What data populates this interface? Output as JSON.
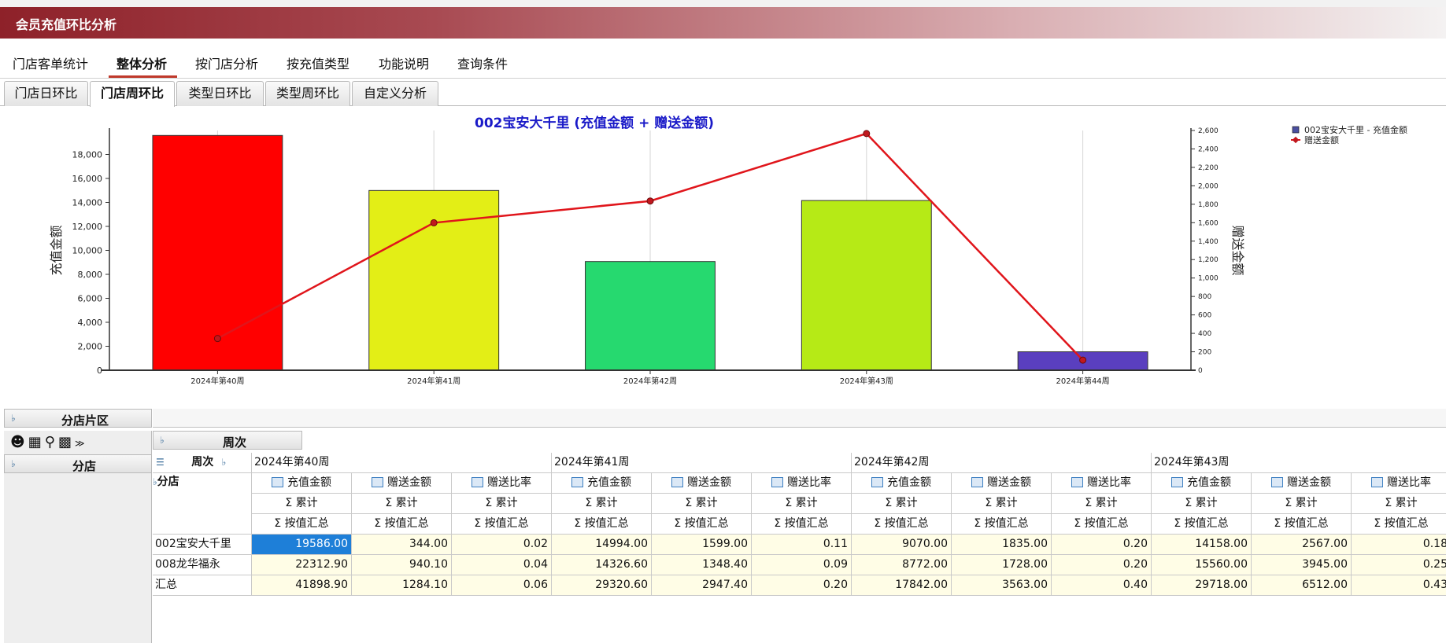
{
  "window": {
    "title": "会员充值环比分析"
  },
  "menu": {
    "items": [
      "门店客单统计",
      "整体分析",
      "按门店分析",
      "按充值类型",
      "功能说明",
      "查询条件"
    ],
    "active_index": 1
  },
  "tabs": {
    "items": [
      "门店日环比",
      "门店周环比",
      "类型日环比",
      "类型周环比",
      "自定义分析"
    ],
    "active_index": 1
  },
  "chart_data": {
    "type": "bar",
    "title": "002宝安大千里 (充值金额 + 赠送金额)",
    "categories": [
      "2024年第40周",
      "2024年第41周",
      "2024年第42周",
      "2024年第43周",
      "2024年第44周"
    ],
    "series": [
      {
        "name": "002宝安大千里 - 充值金额",
        "type": "bar",
        "axis": "left",
        "values": [
          19586,
          14994,
          9070,
          14158,
          1540
        ],
        "colors": [
          "#ff0000",
          "#e3ee16",
          "#26d96f",
          "#b6ea16",
          "#5a3fbf"
        ]
      },
      {
        "name": "赠送金额",
        "type": "line",
        "axis": "right",
        "values": [
          344,
          1599,
          1835,
          2567,
          110
        ],
        "color": "#e0151b"
      }
    ],
    "ylabel": "充值金额",
    "y2label": "赠送金额",
    "ylim": [
      0,
      20000
    ],
    "y2lim": [
      0,
      2600
    ],
    "yticks": [
      "0",
      "2,000",
      "4,000",
      "6,000",
      "8,000",
      "10,000",
      "12,000",
      "14,000",
      "16,000",
      "18,000"
    ],
    "y2ticks": [
      "0",
      "200",
      "400",
      "600",
      "800",
      "1,000",
      "1,200",
      "1,400",
      "1,600",
      "1,800",
      "2,000",
      "2,200",
      "2,400",
      "2,600"
    ],
    "legend_position": "top-right",
    "grid": true
  },
  "pivot": {
    "region_field": "分店片区",
    "column_field": "周次",
    "row_field": "分店",
    "col_header_field": "周次",
    "weeks": [
      "2024年第40周",
      "2024年第41周",
      "2024年第42周",
      "2024年第43周"
    ],
    "measures": [
      "充值金额",
      "赠送金额",
      "赠送比率"
    ],
    "agg1": "Σ 累计",
    "agg2": "Σ 按值汇总",
    "rows": [
      {
        "label": "002宝安大千里",
        "values": [
          "19586.00",
          "344.00",
          "0.02",
          "14994.00",
          "1599.00",
          "0.11",
          "9070.00",
          "1835.00",
          "0.20",
          "14158.00",
          "2567.00",
          "0.18"
        ]
      },
      {
        "label": "008龙华福永",
        "values": [
          "22312.90",
          "940.10",
          "0.04",
          "14326.60",
          "1348.40",
          "0.09",
          "8772.00",
          "1728.00",
          "0.20",
          "15560.00",
          "3945.00",
          "0.25"
        ]
      },
      {
        "label": "汇总",
        "values": [
          "41898.90",
          "1284.10",
          "0.06",
          "29320.60",
          "2947.40",
          "0.20",
          "17842.00",
          "3563.00",
          "0.40",
          "29718.00",
          "6512.00",
          "0.43"
        ]
      }
    ]
  }
}
